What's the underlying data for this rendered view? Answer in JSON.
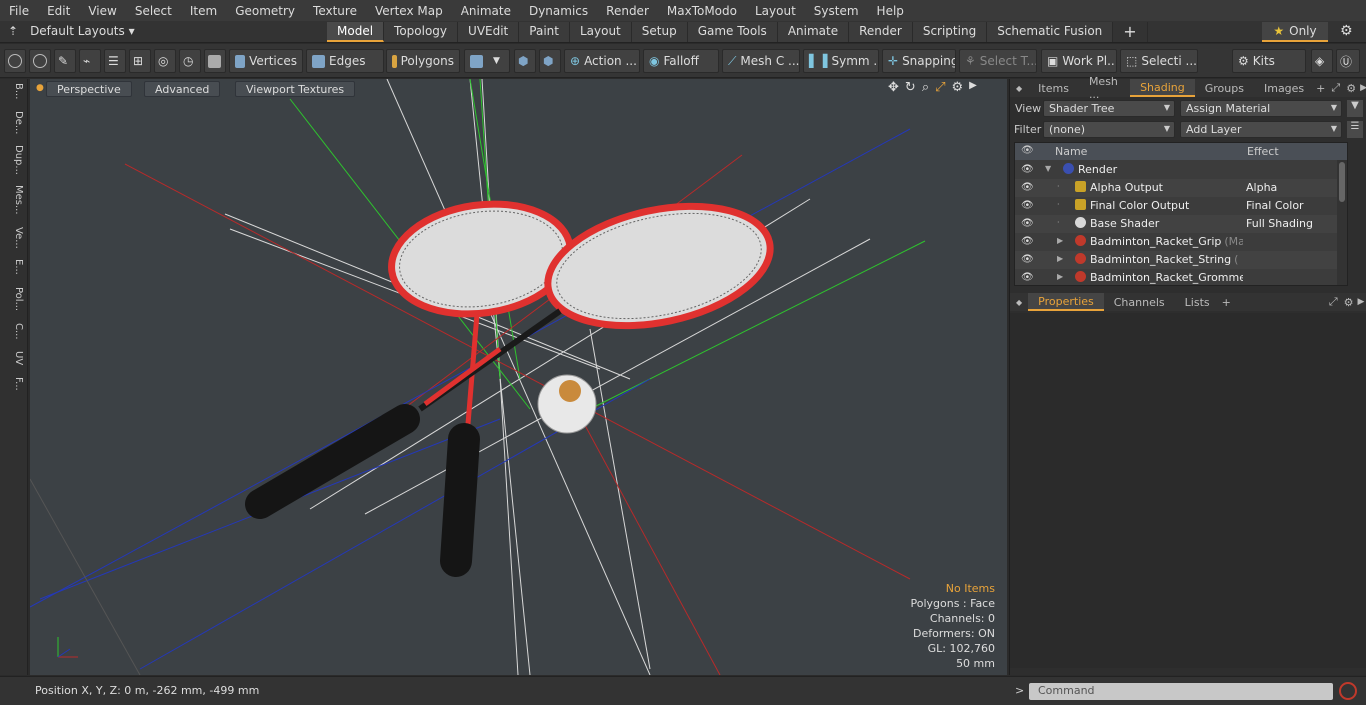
{
  "menu": [
    "File",
    "Edit",
    "View",
    "Select",
    "Item",
    "Geometry",
    "Texture",
    "Vertex Map",
    "Animate",
    "Dynamics",
    "Render",
    "MaxToModo",
    "Layout",
    "System",
    "Help"
  ],
  "layout_dropdown": "Default Layouts",
  "mode_tabs": [
    "Model",
    "Topology",
    "UVEdit",
    "Paint",
    "Layout",
    "Setup",
    "Game Tools",
    "Animate",
    "Render",
    "Scripting",
    "Schematic Fusion"
  ],
  "active_mode_tab": "Model",
  "only_label": "Only",
  "toolbar": {
    "vertices": "Vertices",
    "edges": "Edges",
    "polygons": "Polygons",
    "action": "Action ...",
    "falloff": "Falloff",
    "mesh": "Mesh C ...",
    "symmetry": "Symm ...",
    "snapping": "Snapping",
    "select_t": "Select T...",
    "work_plane": "Work Pl...",
    "selection": "Selecti ...",
    "kits": "Kits"
  },
  "left_strip": [
    "B...",
    "De...",
    "Dup...",
    "Mes...",
    "Ve...",
    "E...",
    "Pol...",
    "C...",
    "UV",
    "F..."
  ],
  "viewport": {
    "buttons": [
      "Perspective",
      "Advanced",
      "Viewport Textures"
    ],
    "info": {
      "selection": "No Items",
      "polygons": "Polygons : Face",
      "channels": "Channels: 0",
      "deformers": "Deformers: ON",
      "gl": "GL: 102,760",
      "scale": "50 mm"
    }
  },
  "right_panel": {
    "tabs_top": [
      "Items",
      "Mesh ...",
      "Shading",
      "Groups",
      "Images"
    ],
    "active_tab_top": "Shading",
    "view_label": "View",
    "view_value": "Shader Tree",
    "assign_material": "Assign Material",
    "filter_label": "Filter",
    "filter_value": "(none)",
    "add_layer": "Add Layer",
    "tree_headers": {
      "name": "Name",
      "effect": "Effect"
    },
    "tree_rows": [
      {
        "name": "Render",
        "effect": "",
        "indent": 0,
        "color": "#3a4fb0"
      },
      {
        "name": "Alpha Output",
        "effect": "Alpha",
        "indent": 1,
        "color": "#c9a227"
      },
      {
        "name": "Final Color Output",
        "effect": "Final Color",
        "indent": 1,
        "color": "#c9a227"
      },
      {
        "name": "Base Shader",
        "effect": "Full Shading",
        "indent": 1,
        "color": "#d8d8d8"
      },
      {
        "name": "Badminton_Racket_Grip",
        "suffix": "(Ma...",
        "effect": "",
        "indent": 1,
        "color": "#c0392b"
      },
      {
        "name": "Badminton_Racket_String",
        "suffix": "( ...",
        "effect": "",
        "indent": 1,
        "color": "#c0392b"
      },
      {
        "name": "Badminton_Racket_Gromme ...",
        "suffix": "",
        "effect": "",
        "indent": 1,
        "color": "#c0392b"
      }
    ],
    "tabs_bottom": [
      "Properties",
      "Channels",
      "Lists"
    ],
    "active_tab_bottom": "Properties"
  },
  "status": {
    "position": "Position X, Y, Z:   0 m, -262 mm, -499 mm",
    "command_placeholder": "Command"
  }
}
